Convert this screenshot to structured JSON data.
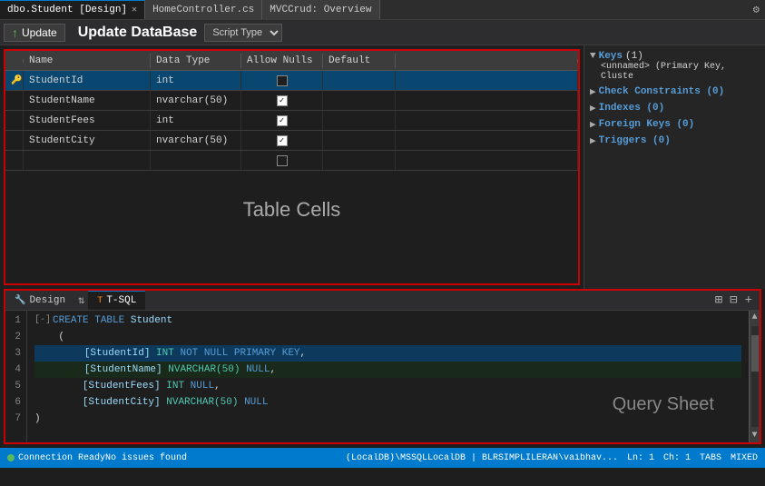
{
  "tabs": [
    {
      "id": "dbo-student",
      "label": "dbo.Student [Design]",
      "active": true,
      "closable": true
    },
    {
      "id": "home-controller",
      "label": "HomeController.cs",
      "active": false,
      "closable": false
    },
    {
      "id": "mvccrud",
      "label": "MVCCrud: Overview",
      "active": false,
      "closable": false
    }
  ],
  "toolbar": {
    "update_btn": "Update",
    "title": "Update DataBase",
    "script_type": "Script Type"
  },
  "table": {
    "columns": [
      "",
      "Name",
      "Data Type",
      "Allow Nulls",
      "Default",
      ""
    ],
    "rows": [
      {
        "key": true,
        "name": "StudentId",
        "type": "int",
        "allow_nulls": false,
        "default": ""
      },
      {
        "key": false,
        "name": "StudentName",
        "type": "nvarchar(50)",
        "allow_nulls": true,
        "default": ""
      },
      {
        "key": false,
        "name": "StudentFees",
        "type": "int",
        "allow_nulls": true,
        "default": ""
      },
      {
        "key": false,
        "name": "StudentCity",
        "type": "nvarchar(50)",
        "allow_nulls": true,
        "default": ""
      },
      {
        "key": false,
        "name": "",
        "type": "",
        "allow_nulls": false,
        "default": ""
      }
    ]
  },
  "table_cells_label": "Table Cells",
  "props": {
    "keys_label": "Keys",
    "keys_count": "(1)",
    "keys_item": "<unnamed>",
    "keys_item_detail": "(Primary Key, Cluste",
    "check_constraints": "Check Constraints (0)",
    "indexes": "Indexes (0)",
    "foreign_keys": "Foreign Keys (0)",
    "triggers": "Triggers (0)"
  },
  "bottom": {
    "tabs": [
      {
        "id": "design",
        "label": "Design",
        "icon": "🔧",
        "active": false
      },
      {
        "id": "tsql",
        "label": "T-SQL",
        "icon": "T",
        "active": true
      }
    ],
    "sql_lines": [
      {
        "num": 1,
        "tokens": [
          {
            "t": "collapse",
            "v": "[-]"
          },
          {
            "t": "kw",
            "v": "CREATE"
          },
          {
            "t": "punct",
            "v": " "
          },
          {
            "t": "kw",
            "v": "TABLE"
          },
          {
            "t": "punct",
            "v": " "
          },
          {
            "t": "id",
            "v": "Student"
          }
        ]
      },
      {
        "num": 2,
        "tokens": [
          {
            "t": "punct",
            "v": "("
          }
        ]
      },
      {
        "num": 3,
        "tokens": [
          {
            "t": "indent",
            "v": "    "
          },
          {
            "t": "id",
            "v": "[StudentId]"
          },
          {
            "t": "punct",
            "v": " "
          },
          {
            "t": "type",
            "v": "INT"
          },
          {
            "t": "punct",
            "v": " "
          },
          {
            "t": "kw",
            "v": "NOT"
          },
          {
            "t": "punct",
            "v": " "
          },
          {
            "t": "kw",
            "v": "NULL"
          },
          {
            "t": "punct",
            "v": " "
          },
          {
            "t": "kw",
            "v": "PRIMARY"
          },
          {
            "t": "punct",
            "v": " "
          },
          {
            "t": "kw",
            "v": "KEY"
          },
          {
            "t": "punct",
            "v": ","
          }
        ]
      },
      {
        "num": 4,
        "tokens": [
          {
            "t": "indent",
            "v": "    "
          },
          {
            "t": "id",
            "v": "[StudentName]"
          },
          {
            "t": "punct",
            "v": " "
          },
          {
            "t": "type",
            "v": "NVARCHAR(50)"
          },
          {
            "t": "punct",
            "v": " "
          },
          {
            "t": "kw",
            "v": "NULL"
          },
          {
            "t": "punct",
            "v": ","
          }
        ]
      },
      {
        "num": 5,
        "tokens": [
          {
            "t": "indent",
            "v": "    "
          },
          {
            "t": "id",
            "v": "[StudentFees]"
          },
          {
            "t": "punct",
            "v": " "
          },
          {
            "t": "type",
            "v": "INT"
          },
          {
            "t": "punct",
            "v": " "
          },
          {
            "t": "kw",
            "v": "NULL"
          },
          {
            "t": "punct",
            "v": ","
          }
        ]
      },
      {
        "num": 6,
        "tokens": [
          {
            "t": "indent",
            "v": "    "
          },
          {
            "t": "id",
            "v": "[StudentCity]"
          },
          {
            "t": "punct",
            "v": " "
          },
          {
            "t": "type",
            "v": "NVARCHAR(50)"
          },
          {
            "t": "punct",
            "v": " "
          },
          {
            "t": "kw",
            "v": "NULL"
          }
        ]
      },
      {
        "num": 7,
        "tokens": [
          {
            "t": "punct",
            "v": ")"
          }
        ]
      }
    ],
    "query_sheet_label": "Query Sheet"
  },
  "status_bar": {
    "connection": "Connection Ready",
    "server": "(LocalDB)\\MSSQLLocalDB  | BLRSIMPLILERAN\\vaibhav... | SimpliMVCDB",
    "ln": "Ln: 1",
    "ch": "Ch: 1",
    "tabs_mode": "TABS",
    "mode": "MIXED",
    "no_issues": "No issues found"
  },
  "colors": {
    "accent_blue": "#007acc",
    "border_red": "#cc0000",
    "keyword_blue": "#569cd6",
    "type_teal": "#4ec9b0",
    "id_lightblue": "#9cdcfe",
    "string_orange": "#ce9178"
  }
}
